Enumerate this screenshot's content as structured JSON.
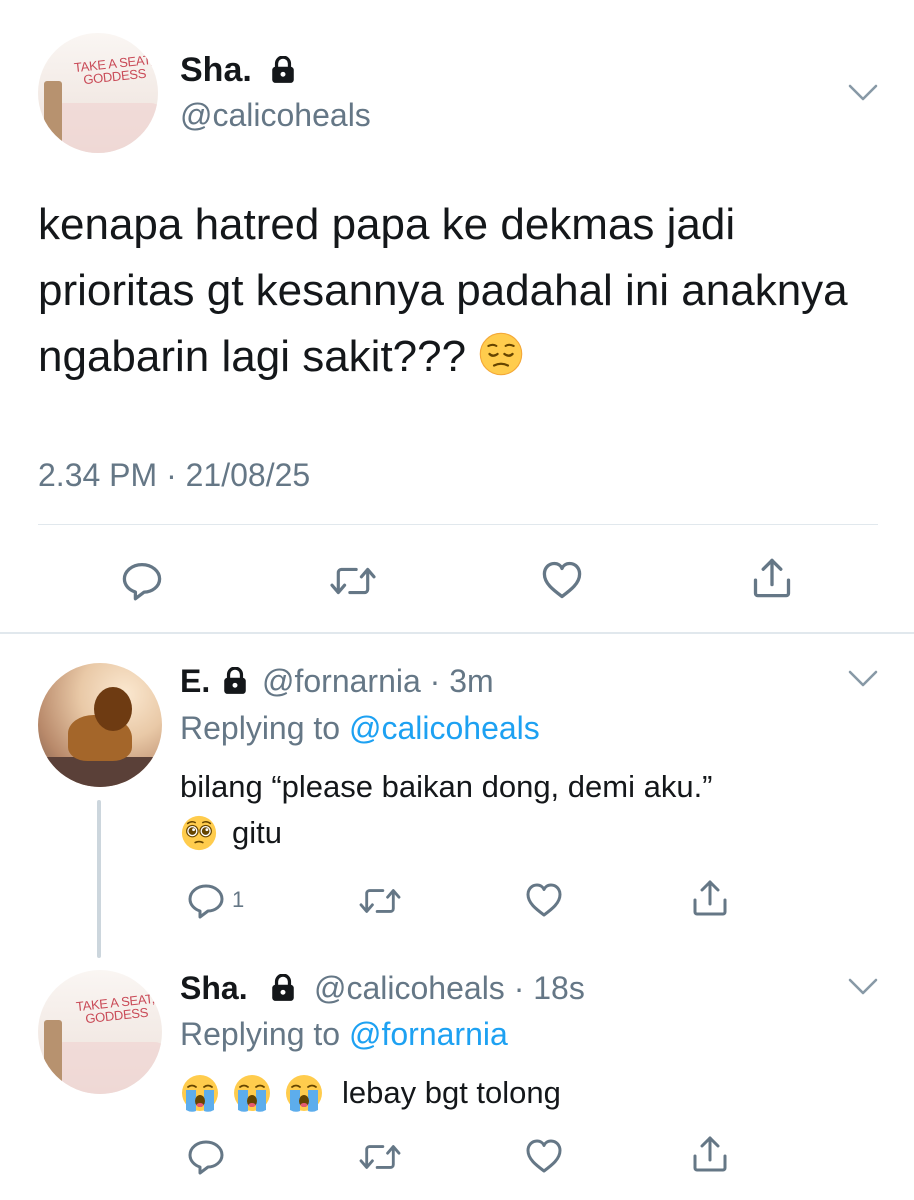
{
  "main_tweet": {
    "author_name": "Sha.",
    "author_handle": "@calicoheals",
    "avatar_text": "TAKE A SEAT,\nGODDESS",
    "text": "kenapa hatred papa ke dekmas jadi prioritas gt kesannya padahal ini anaknya ngabarin lagi sakit???",
    "emoji_icon": "pensive-face-icon",
    "timestamp": "2.34 PM · 21/08/25"
  },
  "replies": [
    {
      "author_name": "E.",
      "author_handle": "@fornarnia",
      "time": "3m",
      "replying_prefix": "Replying to",
      "replying_to": "@calicoheals",
      "text_line1": "bilang “please baikan dong, demi aku.”",
      "text_line2": "gitu",
      "emoji_icon": "pleading-face-icon",
      "reply_count": "1"
    },
    {
      "author_name": "Sha.",
      "author_handle": "@calicoheals",
      "time": "18s",
      "replying_prefix": "Replying to",
      "replying_to": "@fornarnia",
      "avatar_text": "TAKE A SEAT,\nGODDESS",
      "text": "lebay bgt tolong",
      "emoji_icon": "loudly-crying-face-icon"
    }
  ],
  "colors": {
    "text": "#14171a",
    "secondary": "#657786",
    "link": "#1da1f2",
    "divider": "#e1e8ed",
    "thread_line": "#ccd6dd"
  }
}
